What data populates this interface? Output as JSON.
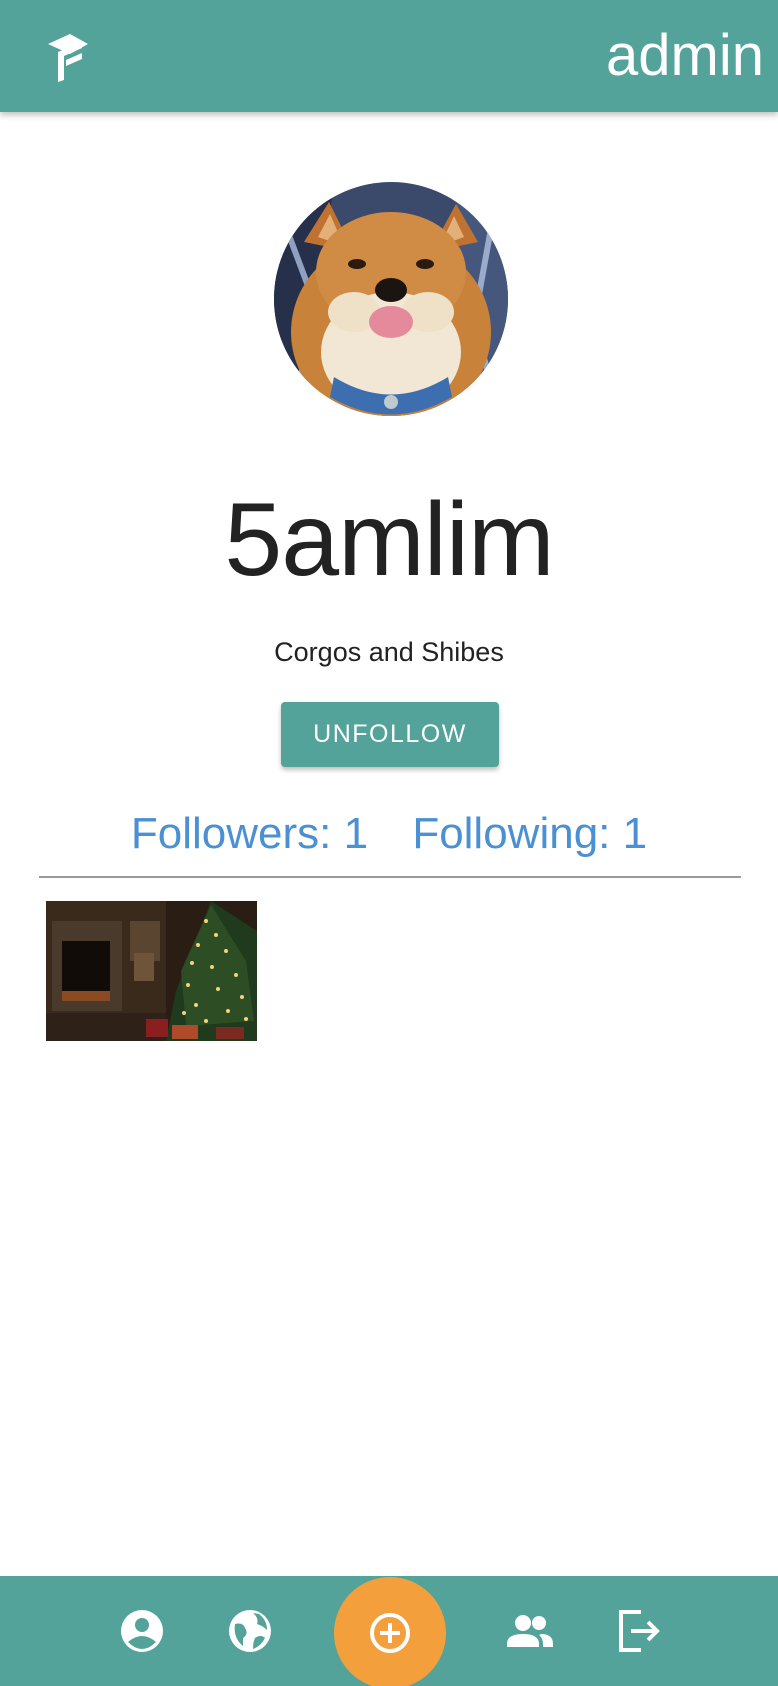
{
  "header": {
    "logo_icon": "app-logo-icon",
    "username": "admin",
    "color": "#53a39a"
  },
  "profile": {
    "avatar": "shiba-dog-avatar",
    "name": "5amlim",
    "bio": "Corgos and Shibes",
    "follow_button_label": "UNFOLLOW",
    "followers_label": "Followers: 1",
    "following_label": "Following: 1",
    "link_color": "#4a90d2"
  },
  "posts": [
    {
      "thumbnail": "christmas-tree-fireplace-photo"
    }
  ],
  "bottom_nav": {
    "items": [
      "profile-icon",
      "globe-icon",
      "add-post-icon",
      "friends-icon",
      "logout-icon"
    ],
    "fab_color": "#f3a03c"
  }
}
